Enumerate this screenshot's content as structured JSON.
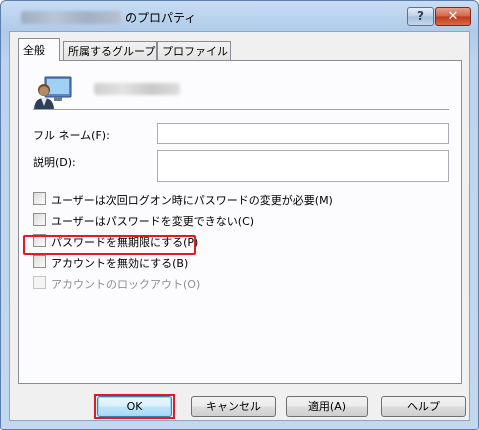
{
  "window": {
    "title": "のプロパティ",
    "help_button": "?",
    "close_button": "✕"
  },
  "tabs": [
    {
      "label": "全般",
      "active": true
    },
    {
      "label": "所属するグループ",
      "active": false
    },
    {
      "label": "プロファイル",
      "active": false
    }
  ],
  "general": {
    "full_name_label": "フル ネーム(F):",
    "full_name_value": "",
    "description_label": "説明(D):",
    "description_value": ""
  },
  "options": [
    {
      "label": "ユーザーは次回ログオン時にパスワードの変更が必要(M)",
      "checked": false,
      "enabled": true
    },
    {
      "label": "ユーザーはパスワードを変更できない(C)",
      "checked": false,
      "enabled": true
    },
    {
      "label": "パスワードを無期限にする(P)",
      "checked": false,
      "enabled": true,
      "highlighted": true
    },
    {
      "label": "アカウントを無効にする(B)",
      "checked": false,
      "enabled": true
    },
    {
      "label": "アカウントのロックアウト(O)",
      "checked": false,
      "enabled": false
    }
  ],
  "buttons": {
    "ok": "OK",
    "cancel": "キャンセル",
    "apply": "適用(A)",
    "help": "ヘルプ"
  },
  "colors": {
    "highlight": "#e01b24",
    "titlebar": "#bcd4ee"
  },
  "icons": {
    "user": "user-icon",
    "close": "close-icon",
    "help": "help-icon"
  }
}
